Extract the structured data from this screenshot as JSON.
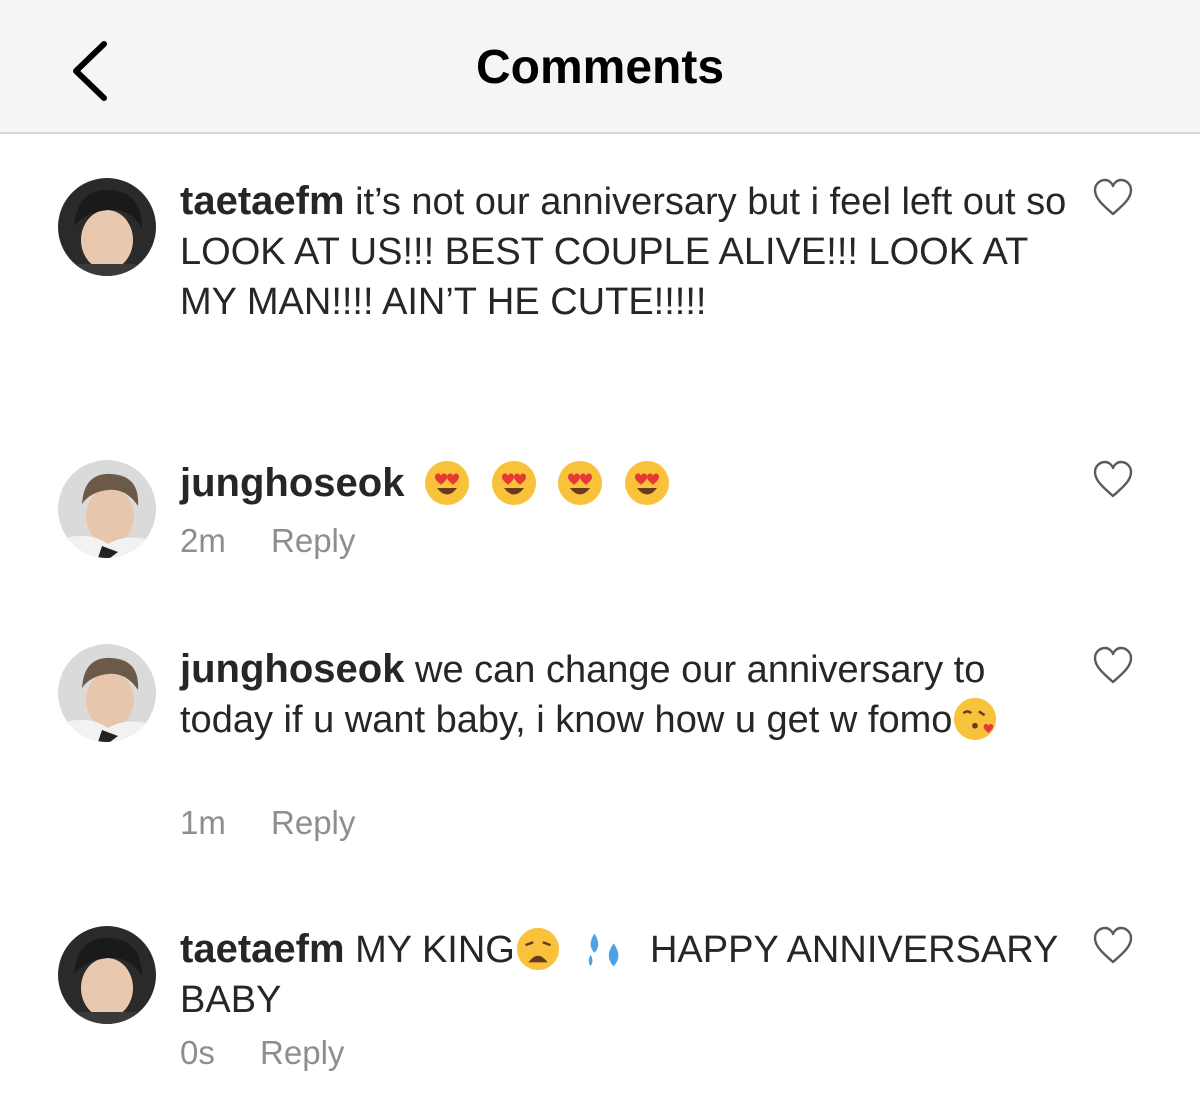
{
  "header": {
    "title": "Comments",
    "back_icon": "chevron-left-icon"
  },
  "comments": [
    {
      "username": "taetaefm",
      "text": "it’s not our anniversary but i feel left out so LOOK AT US!!! BEST COUPLE ALIVE!!! LOOK AT MY MAN!!!! AIN’T HE CUTE!!!!!",
      "time": "",
      "reply_label": ""
    },
    {
      "username": "junghoseok",
      "text": "",
      "emojis": [
        "heart-eyes-emoji",
        "heart-eyes-emoji",
        "heart-eyes-emoji",
        "heart-eyes-emoji"
      ],
      "time": "2m",
      "reply_label": "Reply"
    },
    {
      "username": "junghoseok",
      "text_part1": "we can change our anniversary to today if u want baby, i know how u get w fomo",
      "emojis": [
        "kissing-heart-emoji"
      ],
      "time": "1m",
      "reply_label": "Reply"
    },
    {
      "username": "taetaefm",
      "text_part1": "MY KING",
      "text_part2": "HAPPY ANNIVERSARY BABY",
      "emojis": [
        "weary-face-emoji",
        "sweat-droplets-emoji"
      ],
      "time": "0s",
      "reply_label": "Reply"
    }
  ],
  "colors": {
    "text": "#262626",
    "meta": "#8e8e8e",
    "header_bg": "#f5f5f5"
  }
}
